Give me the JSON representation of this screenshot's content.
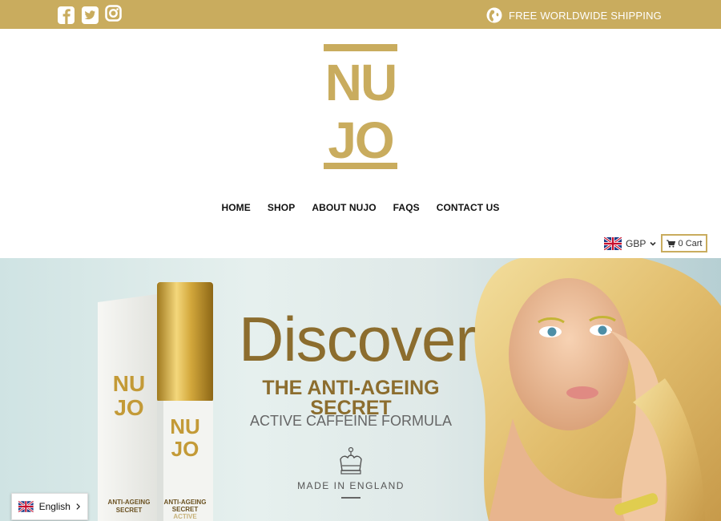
{
  "topbar": {
    "shipping_text": "FREE WORLDWIDE SHIPPING",
    "background": "#c9ac5e"
  },
  "social_icons": [
    "facebook-icon",
    "twitter-icon",
    "instagram-icon"
  ],
  "logo": {
    "line1": "NU",
    "line2": "JO",
    "color": "#c9ac5e"
  },
  "nav": {
    "items": [
      {
        "label": "HOME"
      },
      {
        "label": "SHOP"
      },
      {
        "label": "ABOUT NUJO"
      },
      {
        "label": "FAQS"
      },
      {
        "label": "CONTACT US"
      }
    ]
  },
  "currency": {
    "selected": "GBP",
    "flag_icon": "uk-flag-icon"
  },
  "cart": {
    "label": "0 Cart"
  },
  "hero": {
    "headline": "Discover",
    "subheadline": "THE ANTI-AGEING SECRET",
    "formula": "ACTIVE CAFFEINE FORMULA",
    "made_in": "MADE IN ENGLAND",
    "product_box_brand_1": "NU",
    "product_box_brand_2": "JO",
    "product_box_label": "ANTI-AGEING SECRET",
    "bottle_brand_1": "NU",
    "bottle_brand_2": "JO",
    "bottle_label_line1": "ANTI-AGEING",
    "bottle_label_line2": "SECRET",
    "bottle_label_line3": "ACTIVE CAFFEINE",
    "accent_color": "#8c6d2e"
  },
  "language": {
    "selected": "English"
  }
}
